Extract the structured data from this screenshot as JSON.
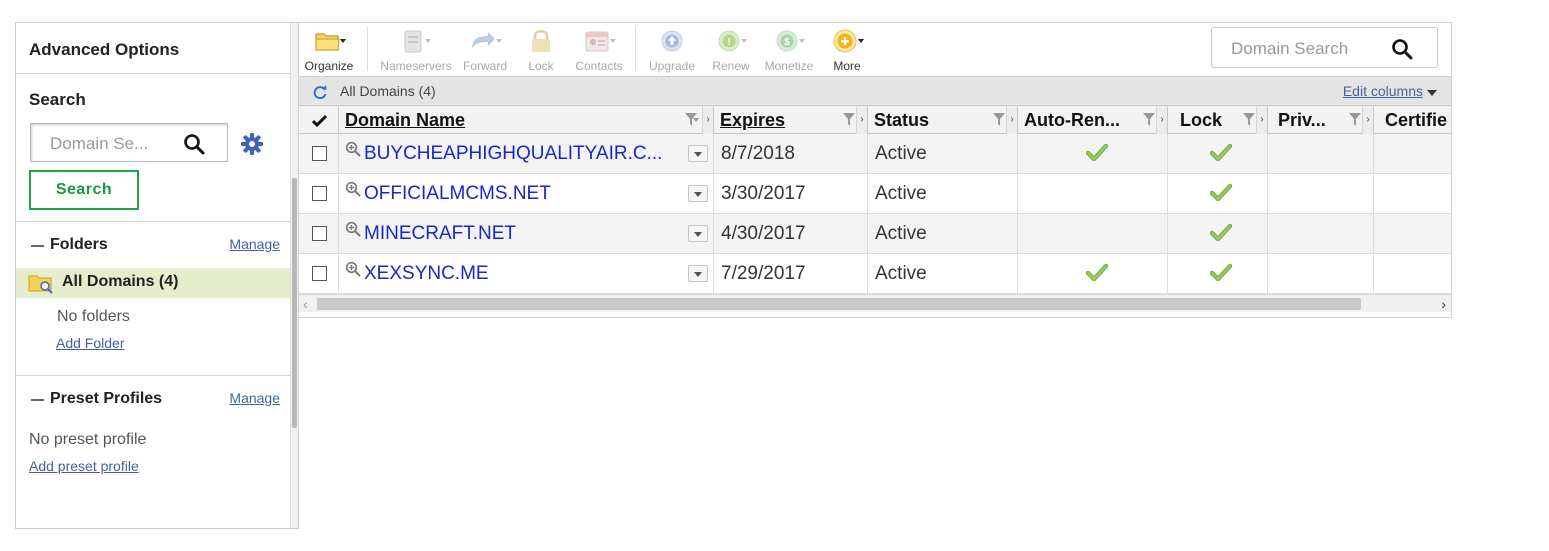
{
  "left_panel": {
    "advanced_title": "Advanced Options",
    "search_title": "Search",
    "search_placeholder": "Domain Se...",
    "search_button": "Search",
    "folders": {
      "title": "Folders",
      "manage": "Manage",
      "all_domains": "All Domains (4)",
      "no_folders": "No folders",
      "add_folder": "Add Folder"
    },
    "preset": {
      "title": "Preset Profiles",
      "manage": "Manage",
      "no_preset": "No preset profile",
      "add_preset": "Add preset profile"
    }
  },
  "toolbar": {
    "organize": "Organize",
    "nameservers": "Nameservers",
    "forward": "Forward",
    "lock": "Lock",
    "contacts": "Contacts",
    "upgrade": "Upgrade",
    "renew": "Renew",
    "monetize": "Monetize",
    "more": "More",
    "search_placeholder": "Domain Search"
  },
  "info_bar": {
    "label": "All Domains (4)",
    "edit_columns": "Edit columns"
  },
  "grid": {
    "headers": {
      "domain_name": "Domain Name",
      "expires": "Expires",
      "status": "Status",
      "auto_renew": "Auto-Ren...",
      "lock": "Lock",
      "privacy": "Priv...",
      "certified": "Certifie"
    },
    "rows": [
      {
        "domain": "BUYCHEAPHIGHQUALITYAIR.C...",
        "expires": "8/7/2018",
        "status": "Active",
        "auto_renew": true,
        "lock": true
      },
      {
        "domain": "OFFICIALMCMS.NET",
        "expires": "3/30/2017",
        "status": "Active",
        "auto_renew": false,
        "lock": true
      },
      {
        "domain": "MINECRAFT.NET",
        "expires": "4/30/2017",
        "status": "Active",
        "auto_renew": false,
        "lock": true
      },
      {
        "domain": "XEXSYNC.ME",
        "expires": "7/29/2017",
        "status": "Active",
        "auto_renew": true,
        "lock": true
      }
    ]
  },
  "colors": {
    "accent_green": "#21a34a",
    "link_blue": "#1a27c8",
    "link_muted": "#44619d",
    "selected_row": "#e5edcc"
  }
}
